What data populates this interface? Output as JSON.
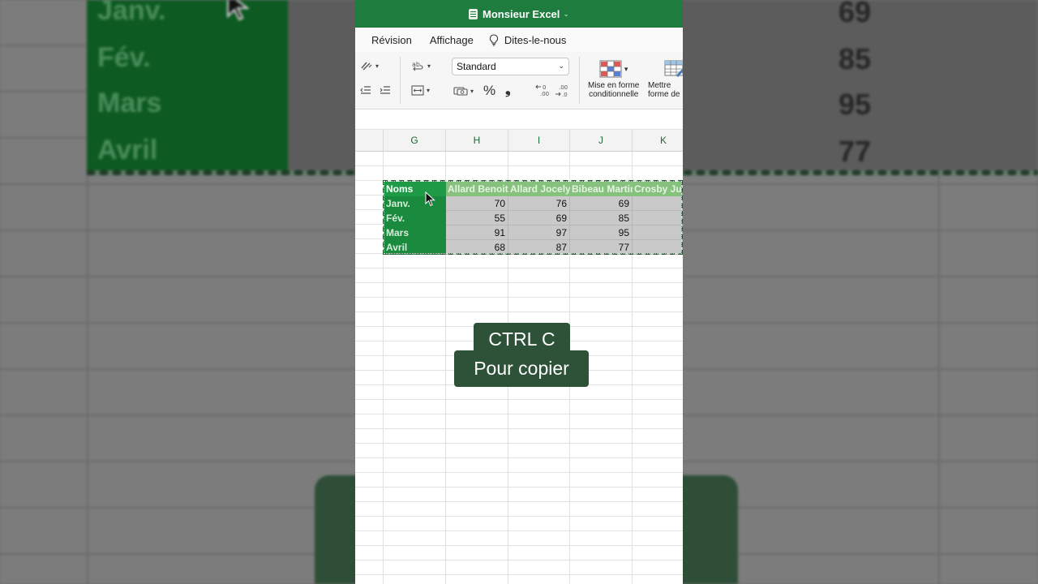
{
  "window": {
    "title": "Monsieur Excel"
  },
  "menu": {
    "tabs": [
      "Révision",
      "Affichage"
    ],
    "tell_me": "Dites-le-nous"
  },
  "ribbon": {
    "number_format": "Standard",
    "percent_symbol": "%",
    "thousands_symbol": "❟",
    "conditional_format_line1": "Mise en forme",
    "conditional_format_line2": "conditionnelle",
    "format_table_line1": "Mettre",
    "format_table_line2": "forme de"
  },
  "columns": [
    "G",
    "H",
    "I",
    "J",
    "K"
  ],
  "table": {
    "corner": "Noms",
    "people": [
      "Allard Benoit",
      "Allard Jocelyn",
      "Bibeau Martin",
      "Crosby Julie"
    ],
    "rows": [
      {
        "label": "Janv.",
        "values": [
          "70",
          "76",
          "69",
          ""
        ]
      },
      {
        "label": "Fév.",
        "values": [
          "55",
          "69",
          "85",
          ""
        ]
      },
      {
        "label": "Mars",
        "values": [
          "91",
          "97",
          "95",
          ""
        ]
      },
      {
        "label": "Avril",
        "values": [
          "68",
          "87",
          "77",
          ""
        ]
      }
    ]
  },
  "caption": {
    "line1": "CTRL C",
    "line2": "Pour copier"
  },
  "background": {
    "months": [
      "Janv.",
      "Fév.",
      "Mars",
      "Avril"
    ],
    "numbers": [
      "69",
      "85",
      "95",
      "77"
    ]
  },
  "colors": {
    "excel_green": "#1e7c3e",
    "caption_bg": "#2e5238",
    "selection_green": "#1f9b48"
  }
}
